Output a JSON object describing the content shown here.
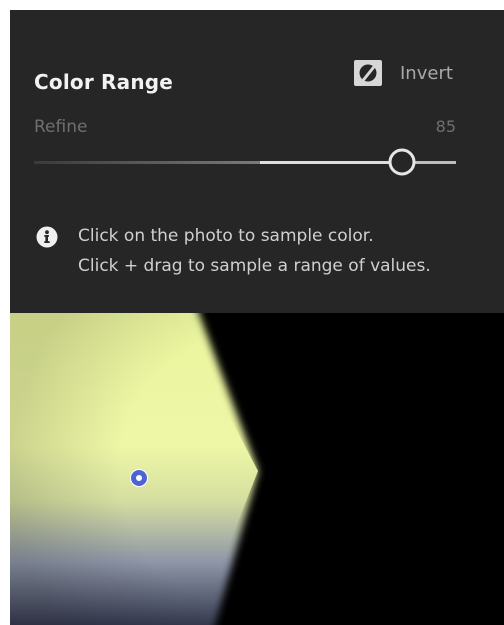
{
  "panel": {
    "title": "Color Range",
    "invert_label": "Invert",
    "invert_icon": "invert-mask-icon",
    "refine": {
      "label": "Refine",
      "value": "85",
      "slider_fraction": 0.85
    },
    "info": {
      "icon": "info-icon",
      "lines": [
        "Click on the photo to sample color.",
        "Click + drag to sample a range of values."
      ]
    }
  },
  "colors": {
    "panel_bg": "#262626",
    "title_text": "#f2f2f2",
    "muted_text": "#6f6f6f",
    "sample_point": "#4c63d6",
    "photo_yellow": "#eaf59d"
  }
}
